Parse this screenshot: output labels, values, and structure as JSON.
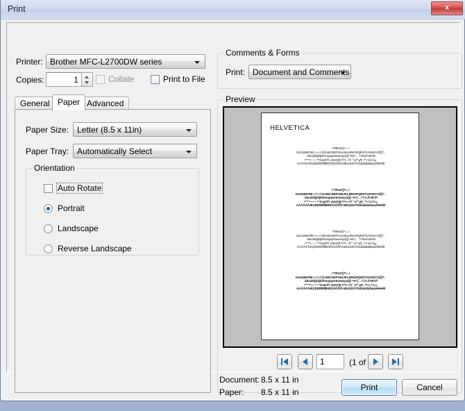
{
  "window": {
    "title": "Print",
    "close_label": "x"
  },
  "printer": {
    "label": "Printer:",
    "value": "Brother MFC-L2700DW series",
    "copies_label": "Copies:",
    "copies_value": "1",
    "collate_label": "Collate",
    "print_to_file_label": "Print to File"
  },
  "tabs": [
    {
      "label": "General",
      "active": false
    },
    {
      "label": "Paper",
      "active": true
    },
    {
      "label": "Advanced",
      "active": false
    }
  ],
  "paper": {
    "size_label": "Paper Size:",
    "size_value": "Letter (8.5 x 11in)",
    "tray_label": "Paper Tray:",
    "tray_value": "Automatically Select",
    "orientation_title": "Orientation",
    "auto_rotate_label": "Auto Rotate",
    "portrait_label": "Portrait",
    "landscape_label": "Landscape",
    "reverse_landscape_label": "Reverse Landscape",
    "selected_orientation": "Portrait"
  },
  "comments": {
    "group_title": "Comments & Forms",
    "print_label": "Print:",
    "print_value": "Document and Comments"
  },
  "preview": {
    "group_title": "Preview",
    "page_title": "HELVETICA",
    "specimen_line_1": "!\"#$%&'()*+,-./",
    "specimen_line_2": "0123456789:;<=>?@ABCDEFGHIJKLMNOPQRSTUVWXYZ[\\]^_",
    "specimen_line_3": "`abcdefghijklmnopqrstuvwxyz{|}~•€•ƒ…†‡‰Š‹Œ•Ž•",
    "specimen_line_4": "•'''\"\"•——™š›œ•žŸ ¡¢£¤¥¦§¨©ª«¬-®¯°±²³´µ¶·¸¹º»¼½¾¿",
    "specimen_line_5": "ÀÁÂÃÄÅÆÇÈÉÊËÌÍÎÏÐÑÒÓÔÕÖ×ØÙÚÛÜÝÞßàáâãäåæçèéêëìíîï",
    "page_input_value": "1",
    "page_counter": "(1 of 4)",
    "first_page_icon": "first-page-icon",
    "prev_page_icon": "previous-page-icon",
    "next_page_icon": "next-page-icon",
    "last_page_icon": "last-page-icon",
    "document_label": "Document:",
    "document_size": "8.5 x 11 in",
    "paper_label": "Paper:",
    "paper_size": "8.5 x 11 in"
  },
  "footer": {
    "print_label": "Print",
    "cancel_label": "Cancel"
  },
  "colors": {
    "accent": "#1b5fa8",
    "default_button": "#b9dcf5",
    "close_button": "#c03a36",
    "window_bg": "#f0f0f0"
  }
}
